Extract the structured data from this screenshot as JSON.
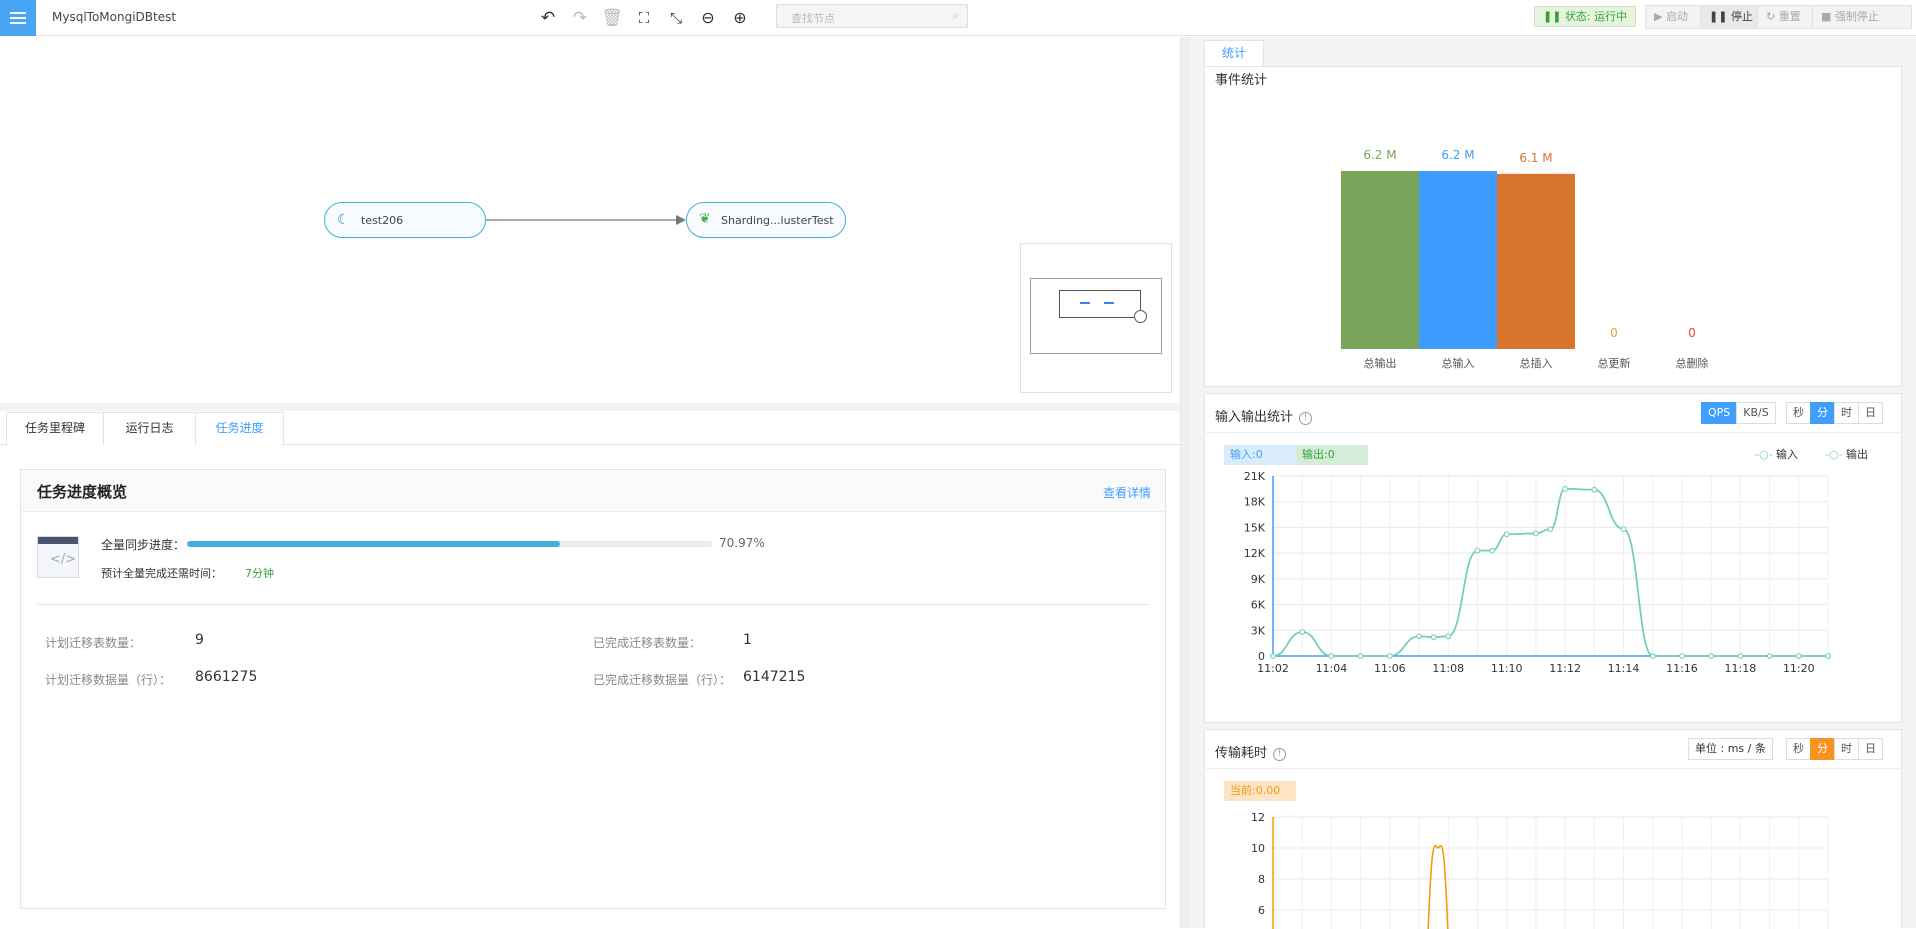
{
  "app": {
    "title": "MysqlToMongiDBtest"
  },
  "toolbar": {
    "search_placeholder": "查找节点",
    "status": "状态: 运行中",
    "start": "启动",
    "stop": "停止",
    "reset": "重置",
    "force_stop": "强制停止"
  },
  "canvas": {
    "source_node": "test206",
    "target_node": "Sharding...lusterTest"
  },
  "bottom_tabs": [
    "任务里程碑",
    "运行日志",
    "任务进度"
  ],
  "progress": {
    "title": "任务进度概览",
    "details_link": "查看详情",
    "full_sync_label": "全量同步进度：",
    "full_sync_pct": "70.97%",
    "full_sync_fraction": 0.7097,
    "eta_label": "预计全量完成还需时间：",
    "eta_value": "7分钟",
    "planned_tables_label": "计划迁移表数量：",
    "planned_tables": "9",
    "done_tables_label": "已完成迁移表数量：",
    "done_tables": "1",
    "planned_rows_label": "计划迁移数据量（行）：",
    "planned_rows": "8661275",
    "done_rows_label": "已完成迁移数据量（行）：",
    "done_rows": "6147215"
  },
  "right": {
    "tab": "统计",
    "event_title": "事件统计",
    "io_title": "输入输出统计",
    "io_units": [
      "QPS",
      "KB/S"
    ],
    "io_ranges": [
      "秒",
      "分",
      "时",
      "日"
    ],
    "io_input_badge": "输入:0",
    "io_output_badge": "输出:0",
    "legend_input": "输入",
    "legend_output": "输出",
    "latency_title": "传输耗时",
    "latency_unit": "单位 : ms / 条",
    "latency_ranges": [
      "秒",
      "分",
      "时",
      "日"
    ],
    "latency_current": "当前:0.00"
  },
  "chart_data": [
    {
      "type": "bar",
      "title": "事件统计",
      "categories": [
        "总输出",
        "总输入",
        "总插入",
        "总更新",
        "总删除"
      ],
      "values": [
        6.2,
        6.2,
        6.1,
        0,
        0
      ],
      "labels": [
        "6.2 M",
        "6.2 M",
        "6.1 M",
        "0",
        "0"
      ],
      "colors": [
        "#78a55a",
        "#3f9cfe",
        "#d9742c",
        "#f39c35",
        "#e8453c"
      ],
      "ylim": [
        0,
        6.2
      ]
    },
    {
      "type": "line",
      "title": "输入输出统计",
      "x": [
        "11:02",
        "11:03",
        "11:04",
        "11:05",
        "11:06",
        "11:07",
        "11:07.5",
        "11:08",
        "11:09",
        "11:09.5",
        "11:10",
        "11:11",
        "11:11.5",
        "11:12",
        "11:13",
        "11:14",
        "11:15",
        "11:16",
        "11:17",
        "11:18",
        "11:19",
        "11:20",
        "11:21"
      ],
      "xticks": [
        "11:02",
        "11:04",
        "11:06",
        "11:08",
        "11:10",
        "11:12",
        "11:14",
        "11:16",
        "11:18",
        "11:20"
      ],
      "yticks": [
        "0",
        "3K",
        "6K",
        "9K",
        "12K",
        "15K",
        "18K",
        "21K"
      ],
      "ylim": [
        0,
        21000
      ],
      "series": [
        {
          "name": "输入",
          "color": "#6fcdbf",
          "values": [
            0,
            2800,
            0,
            0,
            0,
            2300,
            2200,
            2300,
            12300,
            12300,
            14200,
            14300,
            14800,
            19500,
            19400,
            14800,
            0,
            0,
            0,
            0,
            0,
            0,
            0
          ]
        },
        {
          "name": "输出",
          "color": "#8fcfa3",
          "values": [
            0,
            2800,
            0,
            0,
            0,
            2300,
            2200,
            2300,
            12300,
            12300,
            14200,
            14300,
            14800,
            19500,
            19400,
            14800,
            0,
            0,
            0,
            0,
            0,
            0,
            0
          ]
        }
      ]
    },
    {
      "type": "line",
      "title": "传输耗时",
      "yticks": [
        "6",
        "8",
        "10",
        "12"
      ],
      "ylim": [
        6,
        12
      ],
      "series": [
        {
          "color": "#f39c12",
          "values": [
            0,
            10,
            0
          ]
        }
      ]
    }
  ]
}
